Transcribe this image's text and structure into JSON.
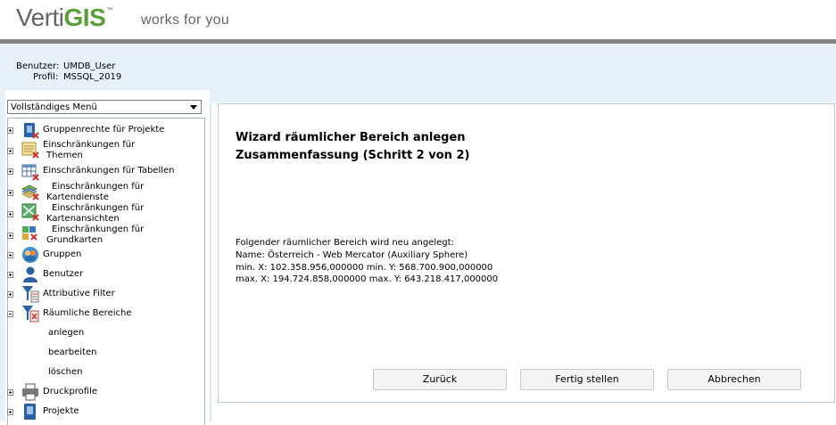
{
  "header": {
    "logo_verti": "Verti",
    "logo_gis": "GIS",
    "logo_tm": "™",
    "tagline": "works for you"
  },
  "user": {
    "user_label": "Benutzer:",
    "user_value": "UMDB_User",
    "profile_label": "Profil:",
    "profile_value": "MSSQL_2019"
  },
  "menu_select": {
    "value": "Vollständiges Menü"
  },
  "tree": {
    "items": [
      {
        "line1": "Gruppenrechte für Projekte",
        "line2": "",
        "expanded": false,
        "icon": "project-rights-icon"
      },
      {
        "line1": "Einschränkungen für",
        "line2": "Themen",
        "expanded": false,
        "icon": "theme-restrictions-icon"
      },
      {
        "line1": "Einschränkungen für Tabellen",
        "line2": "",
        "expanded": false,
        "icon": "table-restrictions-icon"
      },
      {
        "line1": "Einschränkungen für",
        "line2": "Kartendienste",
        "expanded": false,
        "icon": "mapservice-restrictions-icon"
      },
      {
        "line1": "Einschränkungen für",
        "line2": "Kartenansichten",
        "expanded": false,
        "icon": "mapview-restrictions-icon"
      },
      {
        "line1": "Einschränkungen für",
        "line2": "Grundkarten",
        "expanded": false,
        "icon": "basemap-restrictions-icon"
      },
      {
        "line1": "Gruppen",
        "line2": "",
        "expanded": false,
        "icon": "groups-icon"
      },
      {
        "line1": "Benutzer",
        "line2": "",
        "expanded": false,
        "icon": "user-icon"
      },
      {
        "line1": "Attributive Filter",
        "line2": "",
        "expanded": false,
        "icon": "attribute-filter-icon"
      },
      {
        "line1": "Räumliche Bereiche",
        "line2": "",
        "expanded": true,
        "icon": "spatial-filter-icon"
      }
    ],
    "subitems": [
      "anlegen",
      "bearbeiten",
      "löschen"
    ],
    "after": [
      {
        "line1": "Druckprofile",
        "line2": "",
        "expanded": false,
        "icon": "printer-icon"
      },
      {
        "line1": "Projekte",
        "line2": "",
        "expanded": false,
        "icon": "projects-icon"
      }
    ]
  },
  "wizard": {
    "title": "Wizard räumlicher Bereich anlegen",
    "subtitle": "Zusammenfassung (Schritt 2 von 2)",
    "line1": "Folgender räumlicher Bereich wird neu angelegt:",
    "line2": "Name: Österreich - Web Mercator (Auxiliary Sphere)",
    "line3": "min. X: 102.358.956,000000 min. Y: 568.700.900,000000",
    "line4": "max. X: 194.724.858,000000 max. Y: 643.218.417,000000",
    "back_label": "Zurück",
    "finish_label": "Fertig stellen",
    "cancel_label": "Abbrechen"
  },
  "colors": {
    "accent_green": "#5a9e3a",
    "band_blue": "#e8f0f8",
    "header_gray_bar": "#838383",
    "icon_blue": "#2b5fa8",
    "icon_red": "#d0332b"
  }
}
